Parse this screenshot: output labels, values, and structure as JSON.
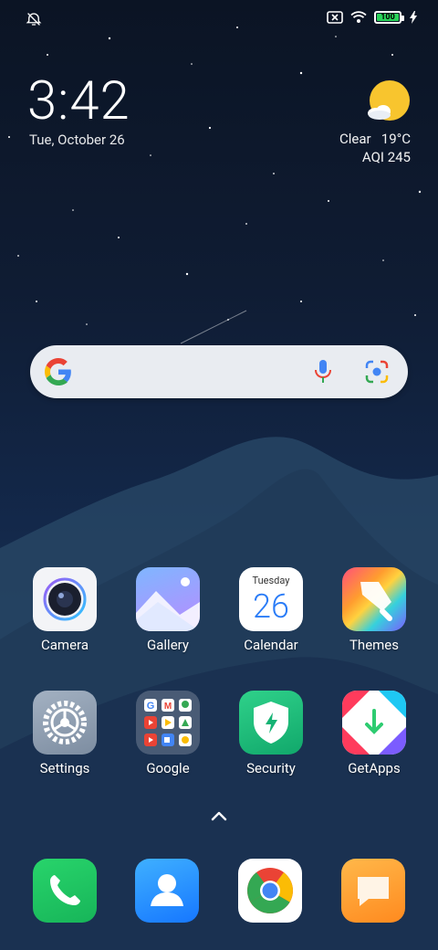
{
  "status_bar": {
    "battery_percent": "100",
    "icons": [
      "alarm-off-icon",
      "sim-off-icon",
      "wifi-icon",
      "battery-icon",
      "charging-icon"
    ]
  },
  "clock": {
    "time": "3:42",
    "date": "Tue, October 26"
  },
  "weather": {
    "condition": "Clear",
    "temperature": "19°C",
    "aqi": "AQI 245",
    "icon": "sun-cloud-icon"
  },
  "search": {
    "icons": [
      "google-g-icon",
      "mic-icon",
      "lens-icon"
    ]
  },
  "apps_row1": [
    {
      "label": "Camera",
      "icon": "camera-icon"
    },
    {
      "label": "Gallery",
      "icon": "gallery-icon"
    },
    {
      "label": "Calendar",
      "icon": "calendar-icon",
      "day_name": "Tuesday",
      "day_number": "26"
    },
    {
      "label": "Themes",
      "icon": "themes-icon"
    }
  ],
  "apps_row2": [
    {
      "label": "Settings",
      "icon": "settings-icon"
    },
    {
      "label": "Google",
      "icon": "google-folder-icon"
    },
    {
      "label": "Security",
      "icon": "security-icon"
    },
    {
      "label": "GetApps",
      "icon": "getapps-icon"
    }
  ],
  "dock": [
    {
      "icon": "phone-icon"
    },
    {
      "icon": "contacts-icon"
    },
    {
      "icon": "chrome-icon"
    },
    {
      "icon": "messages-icon"
    }
  ],
  "colors": {
    "battery_fill": "#2ad35a",
    "search_bg": "#e9ecf1",
    "phone_bg": "#22c55e",
    "contacts_bg": "#1e90ff",
    "messages_bg": "#ff9f2e"
  }
}
